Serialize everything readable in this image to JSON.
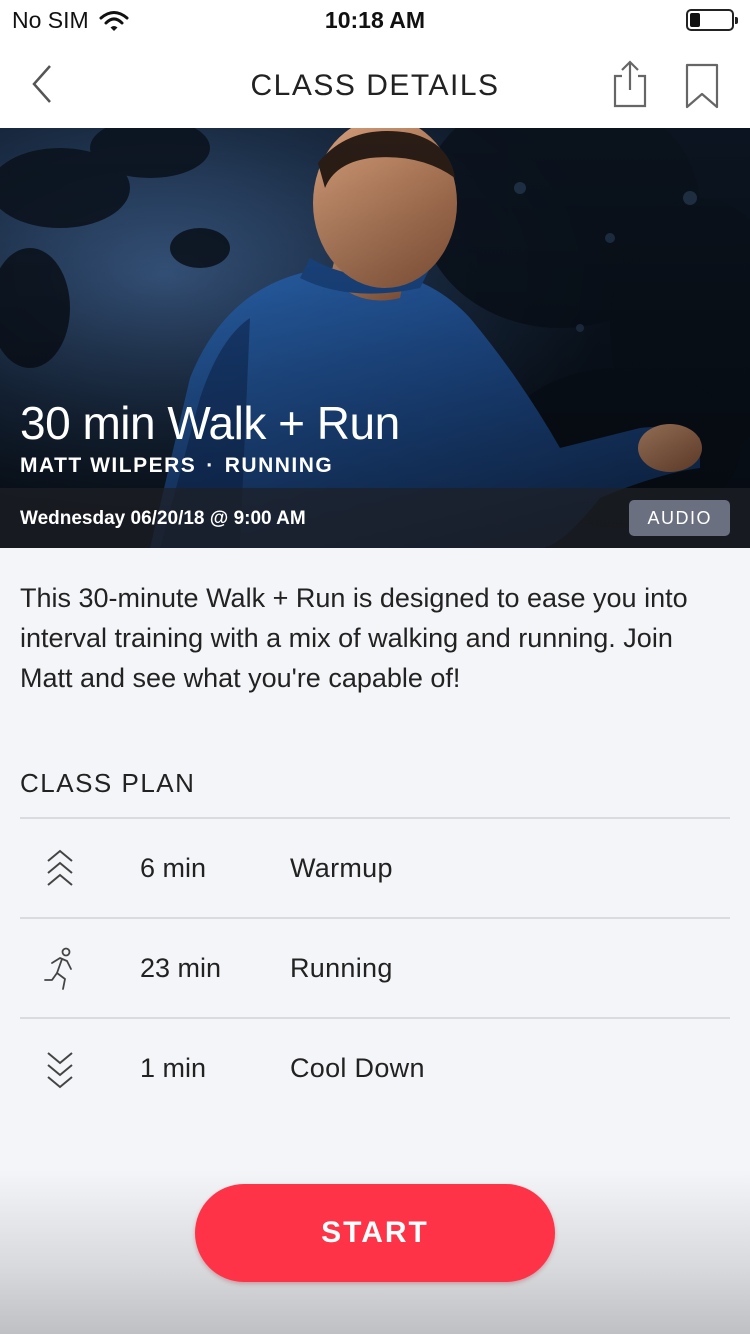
{
  "status_bar": {
    "carrier": "No SIM",
    "time": "10:18 AM",
    "battery_level": 0.25
  },
  "nav": {
    "title": "CLASS DETAILS",
    "icons": [
      "back-icon",
      "share-icon",
      "bookmark-icon"
    ]
  },
  "hero": {
    "title": "30 min Walk + Run",
    "instructor": "MATT WILPERS",
    "separator": "·",
    "category": "RUNNING",
    "date": "Wednesday 06/20/18 @ 9:00 AM",
    "badge": "AUDIO"
  },
  "description": "This 30-minute Walk + Run is designed to ease you into interval training with a mix of walking and running. Join Matt and see what you're capable of!",
  "class_plan": {
    "heading": "CLASS PLAN",
    "items": [
      {
        "icon": "warmup-chevrons-up-icon",
        "duration": "6 min",
        "name": "Warmup"
      },
      {
        "icon": "running-person-icon",
        "duration": "23 min",
        "name": "Running"
      },
      {
        "icon": "cooldown-chevrons-down-icon",
        "duration": "1 min",
        "name": "Cool Down"
      }
    ]
  },
  "actions": {
    "start_label": "START"
  },
  "colors": {
    "accent": "#ff3347",
    "badge": "#6b7080",
    "background": "#f4f5f8"
  }
}
